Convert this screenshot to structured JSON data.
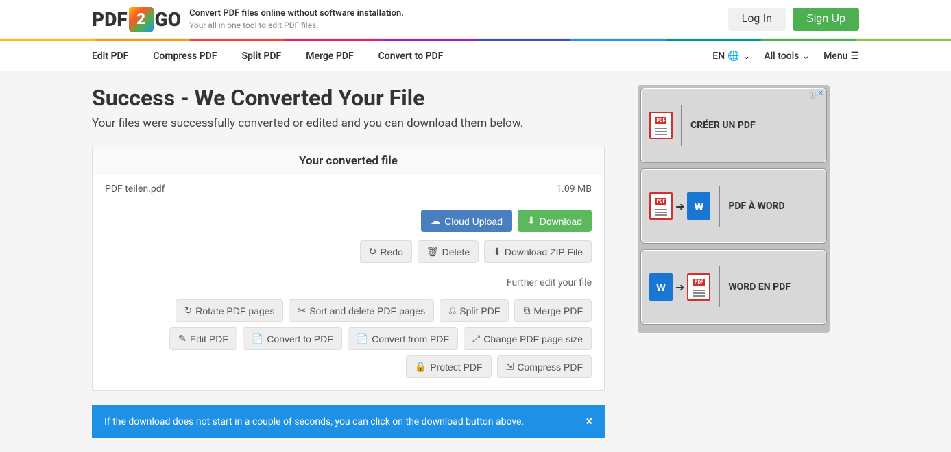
{
  "header": {
    "logo_text_1": "PDF",
    "logo_text_2": "2",
    "logo_text_3": "GO",
    "tagline_main": "Convert PDF files online without software installation.",
    "tagline_sub": "Your all in one tool to edit PDF files.",
    "login_label": "Log In",
    "signup_label": "Sign Up"
  },
  "nav": {
    "links": [
      "Edit PDF",
      "Compress PDF",
      "Split PDF",
      "Merge PDF",
      "Convert to PDF"
    ],
    "lang": "EN",
    "alltools": "All tools",
    "menu": "Menu"
  },
  "page": {
    "title": "Success - We Converted Your File",
    "subtitle": "Your files were successfully converted or edited and you can download them below."
  },
  "card": {
    "header": "Your converted file",
    "file_name": "PDF teilen.pdf",
    "file_size": "1.09 MB",
    "cloud_upload": "Cloud Upload",
    "download": "Download",
    "redo": "Redo",
    "delete": "Delete",
    "download_zip": "Download ZIP File",
    "further_edit": "Further edit your file",
    "tools": [
      "Rotate PDF pages",
      "Sort and delete PDF pages",
      "Split PDF",
      "Merge PDF",
      "Edit PDF",
      "Convert to PDF",
      "Convert from PDF",
      "Change PDF page size",
      "Protect PDF",
      "Compress PDF"
    ]
  },
  "alert": {
    "text": "If the download does not start in a couple of seconds, you can click on the download button above.",
    "close": "×"
  },
  "ads": [
    {
      "text": "CRÉER UN PDF"
    },
    {
      "text": "PDF À WORD"
    },
    {
      "text": "WORD EN PDF"
    }
  ]
}
